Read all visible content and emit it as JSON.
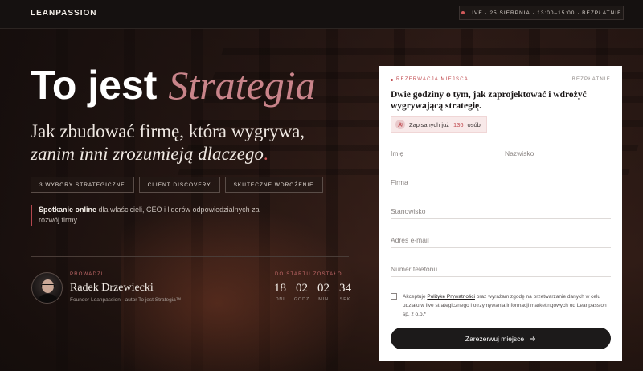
{
  "header": {
    "brand": "LEANPASSION",
    "live_badge": "LIVE · 25 SIERPNIA · 13:00–15:00 · BEZPŁATNIE"
  },
  "hero": {
    "title_main": "To jest",
    "title_accent": "Strategia",
    "subtitle_line1": "Jak zbudować firmę, która wygrywa,",
    "subtitle_line2": "zanim inni zrozumieją dlaczego",
    "subtitle_dot": ".",
    "tags": [
      "3 WYBORY STRATEGICZNE",
      "CLIENT DISCOVERY",
      "SKUTECZNE WDROŻENIE"
    ],
    "desc_bold": "Spotkanie online",
    "desc_rest": " dla właścicieli, CEO i liderów odpowiedzialnych za rozwój firmy."
  },
  "host": {
    "label": "PROWADZI",
    "name": "Radek Drzewiecki",
    "role": "Founder Leanpassion · autor To jest Strategia™"
  },
  "countdown": {
    "label": "DO STARTU ZOSTAŁO",
    "items": [
      {
        "value": "18",
        "unit": "DNI"
      },
      {
        "value": "02",
        "unit": "GODZ"
      },
      {
        "value": "02",
        "unit": "MIN"
      },
      {
        "value": "34",
        "unit": "SEK"
      }
    ]
  },
  "form": {
    "label": "REZERWACJA MIEJSCA",
    "free": "BEZPŁATNIE",
    "title": "Dwie godziny o tym, jak zaprojektować i wdrożyć wygrywającą strategię.",
    "signup_prefix": "Zapisanych już",
    "signup_count": "136",
    "signup_suffix": "osób",
    "first_name_placeholder": "Imię",
    "last_name_placeholder": "Nazwisko",
    "company_placeholder": "Firma",
    "position_placeholder": "Stanowisko",
    "email_placeholder": "Adres e-mail",
    "phone_placeholder": "Numer telefonu",
    "consent_prefix": "Akceptuję",
    "consent_link": "Politykę Prywatności",
    "consent_rest": "oraz wyrażam zgodę na przetwarzanie danych w celu udziału w live strategicznego i otrzymywania informacji marketingowych od Leanpassion sp. z o.o.*",
    "submit_label": "Zarezerwuj miejsce"
  },
  "colors": {
    "accent": "#c04a4f",
    "title_accent": "#c9848a",
    "button_bg": "#1c1a1a"
  }
}
